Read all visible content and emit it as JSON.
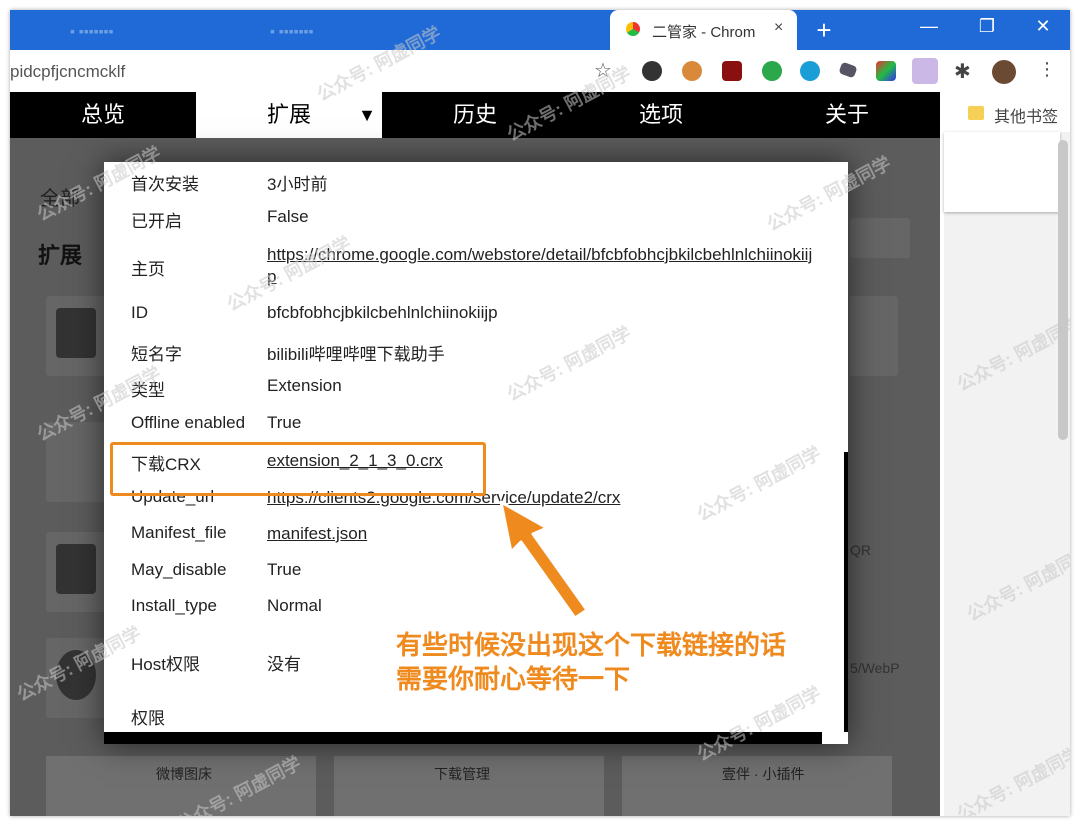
{
  "browser": {
    "active_tab_title": "二管家 - Chrom",
    "tab_close": "×",
    "new_tab": "+",
    "window_controls": [
      "—",
      "❐",
      "✕"
    ],
    "url": "pidcpfjcncmcklf",
    "bookmark_star": "☆",
    "puzzle": "✱",
    "menu": "⋮",
    "bookmark_folder_label": "其他书签"
  },
  "nav": {
    "items": [
      "总览",
      "扩展",
      "历史",
      "选项",
      "关于"
    ],
    "active_index": 1,
    "caret": "▼"
  },
  "page": {
    "filter_label": "全部",
    "section_title": "扩展",
    "bottom_cards": [
      "微博图床",
      "下载管理",
      "壹伴 · 小插件"
    ],
    "side_text_1": "QR",
    "side_text_2": "5/WebP"
  },
  "details": {
    "rows": [
      {
        "key": "首次安装",
        "value": "3小时前",
        "link": false
      },
      {
        "key": "已开启",
        "value": "False",
        "link": false
      },
      {
        "key": "主页",
        "value": "https://chrome.google.com/webstore/detail/bfcbfobhcjbkilcbehlnlchiinokiijp",
        "link": true
      },
      {
        "key": "ID",
        "value": "bfcbfobhcjbkilcbehlnlchiinokiijp",
        "link": false
      },
      {
        "key": "短名字",
        "value": "bilibili哔哩哔哩下载助手",
        "link": false
      },
      {
        "key": "类型",
        "value": "Extension",
        "link": false
      },
      {
        "key": "Offline enabled",
        "value": "True",
        "link": false
      },
      {
        "key": "下载CRX",
        "value": "extension_2_1_3_0.crx",
        "link": true
      },
      {
        "key": "Update_url",
        "value": "https://clients2.google.com/service/update2/crx",
        "link": true
      },
      {
        "key": "Manifest_file",
        "value": "manifest.json",
        "link": true
      },
      {
        "key": "May_disable",
        "value": "True",
        "link": false
      },
      {
        "key": "Install_type",
        "value": "Normal",
        "link": false
      },
      {
        "key": "Host权限",
        "value": "没有",
        "link": false
      },
      {
        "key": "权限",
        "value": "",
        "link": false
      }
    ]
  },
  "annotation": {
    "callout_line1": "有些时候没出现这个下载链接的话",
    "callout_line2": "需要你耐心等待一下",
    "color": "#ef8a1f"
  },
  "watermark_text": "公众号: 阿虚同学"
}
